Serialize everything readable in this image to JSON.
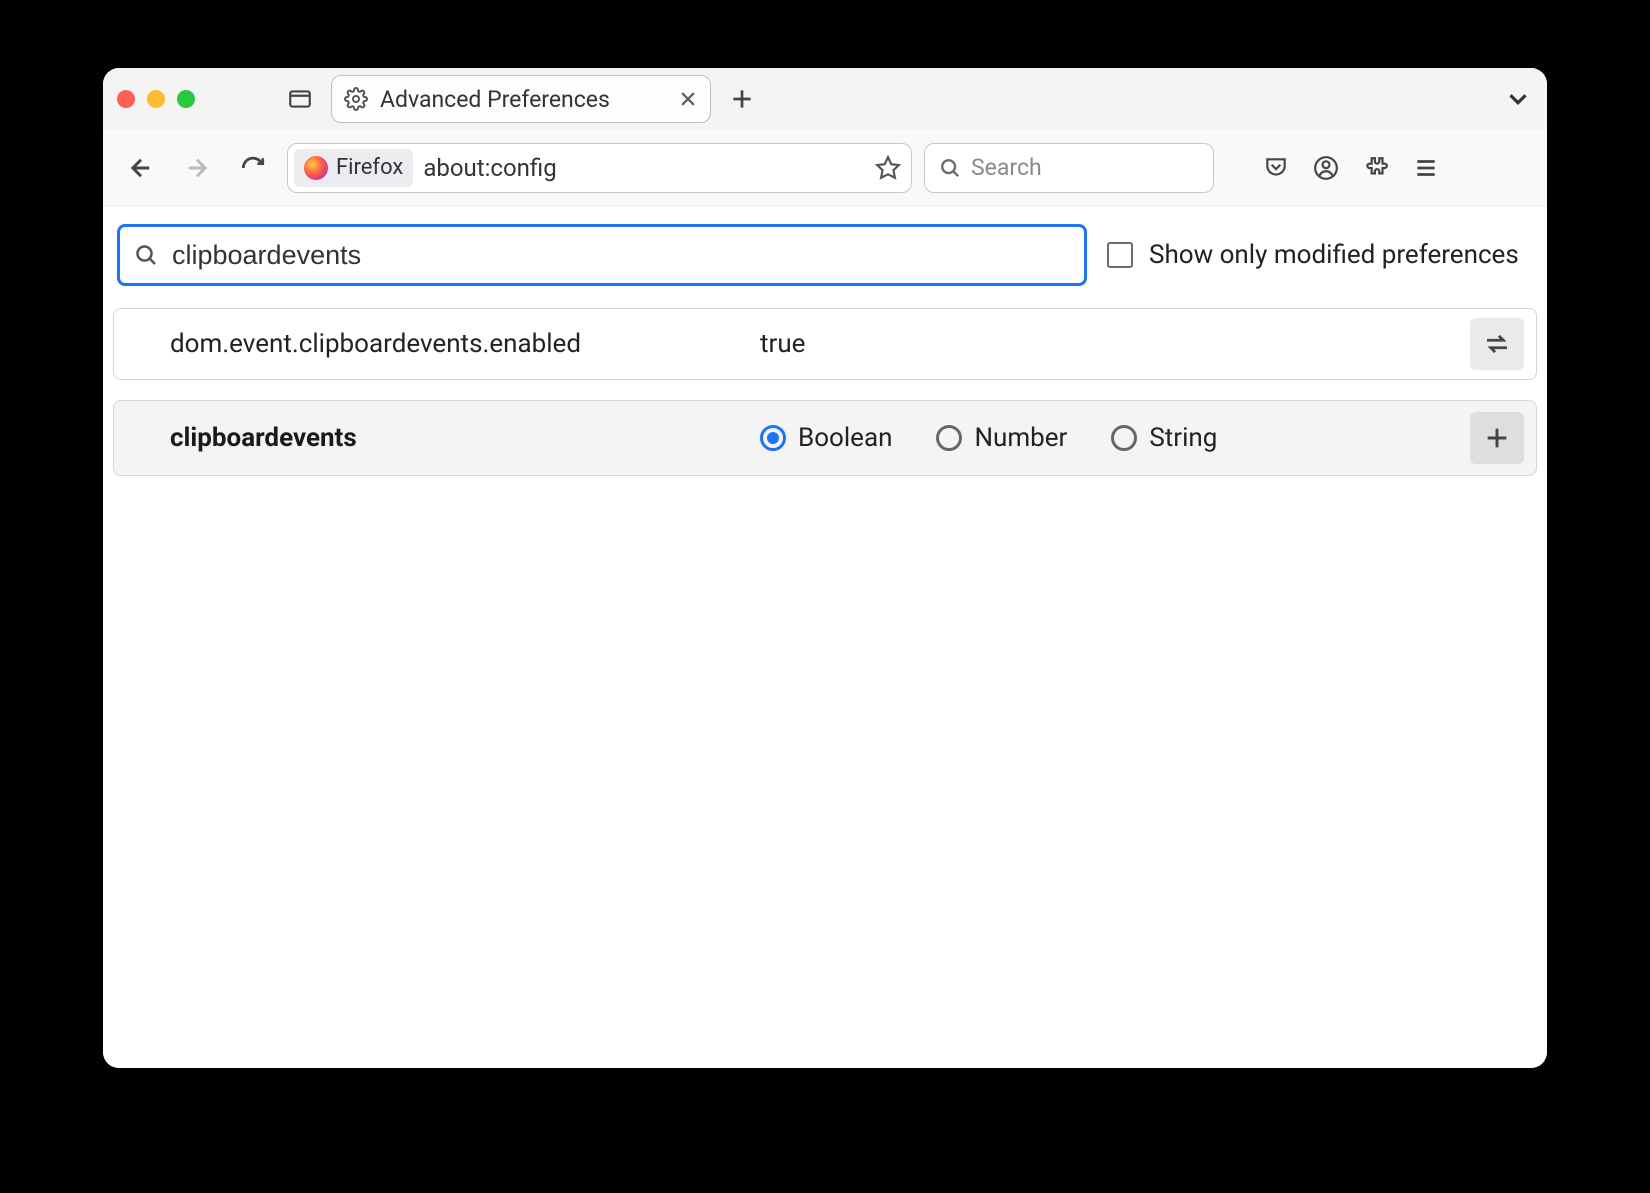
{
  "tab": {
    "title": "Advanced Preferences"
  },
  "urlbar": {
    "badge": "Firefox",
    "url": "about:config"
  },
  "searchbar": {
    "placeholder": "Search"
  },
  "config": {
    "search_value": "clipboardevents",
    "show_modified_label": "Show only modified preferences",
    "prefs": [
      {
        "name": "dom.event.clipboardevents.enabled",
        "value": "true"
      }
    ],
    "new_pref": {
      "name": "clipboardevents",
      "types": [
        "Boolean",
        "Number",
        "String"
      ],
      "selected": "Boolean"
    }
  }
}
